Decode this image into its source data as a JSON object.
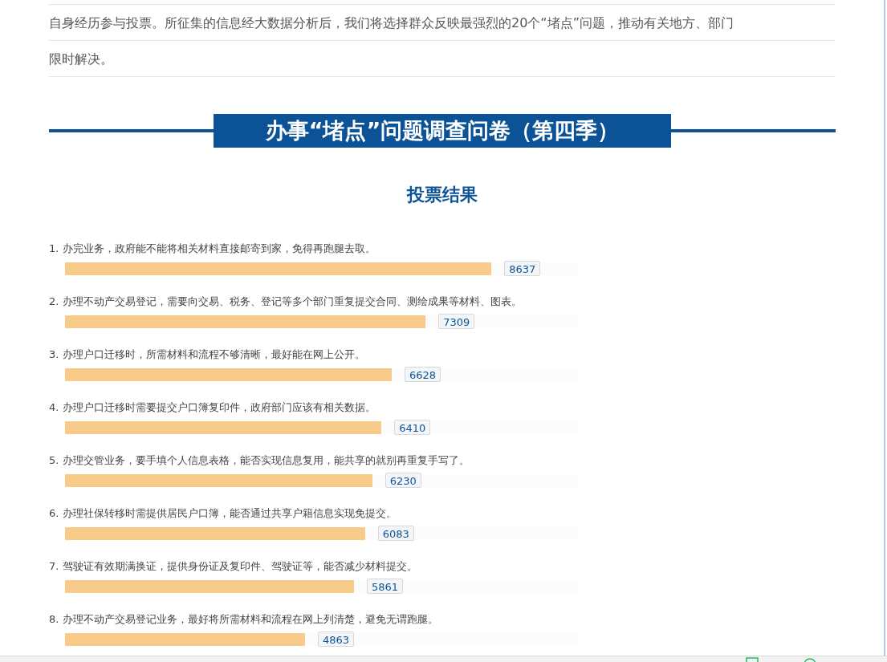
{
  "intro": {
    "lines": [
      "自身经历参与投票。所征集的信息经大数据分析后，我们将选择群众反映最强烈的20个“堵点”问题，推动有关地方、部门",
      "限时解决。"
    ]
  },
  "banner": {
    "title": "办事“堵点”问题调查问卷（第四季）"
  },
  "results": {
    "title": "投票结果",
    "items": [
      {
        "label": "1. 办完业务，政府能不能将相关材料直接邮寄到家，免得再跑腿去取。",
        "level": 0.83,
        "count": "8637"
      },
      {
        "label": "2. 办理不动产交易登记，需要向交易、税务、登记等多个部门重复提交合同、测绘成果等材料、图表。",
        "level": 0.702,
        "count": "7309"
      },
      {
        "label": "3. 办理户口迁移时，所需材料和流程不够清晰，最好能在网上公开。",
        "level": 0.636,
        "count": "6628"
      },
      {
        "label": "4. 办理户口迁移时需要提交户口簿复印件，政府部门应该有相关数据。",
        "level": 0.616,
        "count": "6410"
      },
      {
        "label": "5. 办理交管业务，要手填个人信息表格，能否实现信息复用，能共享的就别再重复手写了。",
        "level": 0.598,
        "count": "6230"
      },
      {
        "label": "6. 办理社保转移时需提供居民户口簿，能否通过共享户籍信息实现免提交。",
        "level": 0.584,
        "count": "6083"
      },
      {
        "label": "7. 驾驶证有效期满换证，提供身份证及复印件、驾驶证等，能否减少材料提交。",
        "level": 0.5625,
        "count": "5861"
      },
      {
        "label": "8. 办理不动产交易登记业务，最好将所需材料和流程在网上列清楚，避免无谓跑腿。",
        "level": 0.467,
        "count": "4863"
      }
    ]
  }
}
